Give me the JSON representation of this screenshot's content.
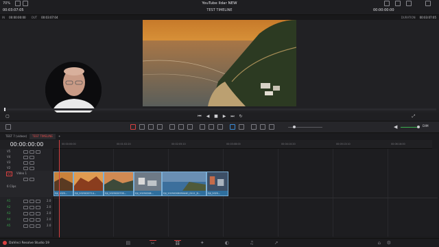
{
  "titlebar": {
    "zoom": "70%",
    "project": "YouTube Ildar NEW",
    "timeline_name": "TEST TIMELINE",
    "timecode_left": "00:03:07:05",
    "timecode_right": "00:00:00:00",
    "duration_label": "DURATION",
    "duration_value": "00:03:07:05"
  },
  "infobar": {
    "in_label": "IN",
    "in_value": "00:00:00:00",
    "out_label": "OUT",
    "out_value": "00:03:07:04"
  },
  "tabs": [
    {
      "label": "TEST 7 (videos)"
    },
    {
      "label": "TEST TIMELINE"
    }
  ],
  "timeline": {
    "timecode": "00:00:00:00",
    "ruler_ticks": [
      "00:00:00:00",
      "00:01:02:20",
      "00:02:05:10",
      "00:03:08:00",
      "00:04:10:20",
      "00:05:13:10",
      "00:06:16:00"
    ],
    "video_tracks": [
      {
        "id": "V5"
      },
      {
        "id": "V4"
      },
      {
        "id": "V3"
      },
      {
        "id": "V2"
      },
      {
        "id": "V1",
        "name": "Video 1",
        "clips_count": "6 Clips"
      }
    ],
    "audio_tracks": [
      {
        "id": "A1",
        "level": "2.0"
      },
      {
        "id": "A2",
        "level": "2.0"
      },
      {
        "id": "A3",
        "level": "2.0"
      },
      {
        "id": "A4",
        "level": "2.0"
      },
      {
        "id": "A5",
        "level": "2.0"
      }
    ],
    "clips": [
      {
        "label": "DJI_2025..."
      },
      {
        "label": "DJI_2025020714..."
      },
      {
        "label": "DJI_2025020705..."
      },
      {
        "label": "DJI_20250208..."
      },
      {
        "label": "DJI_20250208050440_0111_D..."
      },
      {
        "label": "DJI_2025..."
      }
    ]
  },
  "transport": {
    "audio_label": "DIM"
  },
  "bottombar": {
    "app_name": "DaVinci Resolve Studio 19"
  },
  "colors": {
    "accent_red": "#d94040",
    "clip_blue": "#2f6f9e"
  }
}
